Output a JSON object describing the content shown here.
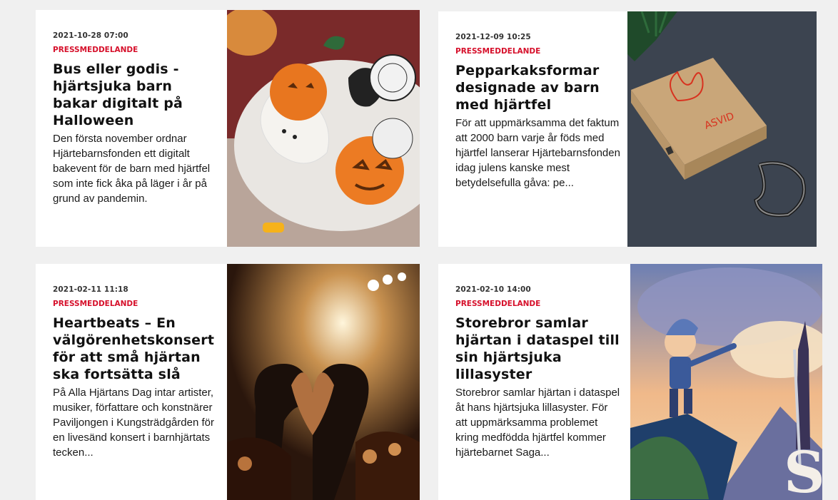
{
  "cards": [
    {
      "date": "2021-10-28 07:00",
      "category": "PRESSMEDDELANDE",
      "title": "Bus eller godis - hjärtsjuka barn bakar digitalt på Halloween",
      "excerpt": "Den första november ordnar Hjärtebarnsfonden ett digitalt bakevent för de barn med hjärtfel som inte fick åka på läger i år på grund av pandemin.",
      "image": "halloween-cookies-photo"
    },
    {
      "date": "2021-12-09 10:25",
      "category": "PRESSMEDDELANDE",
      "title": "Pepparkaksformar designade av barn med hjärtfel",
      "excerpt": "För att uppmärksamma det faktum att 2000 barn varje år föds med hjärtfel lanserar Hjärtebarnsfonden idag julens kanske mest betydelsefulla gåva: pe...",
      "image": "cookie-cutter-box-photo"
    },
    {
      "date": "2021-02-11 11:18",
      "category": "PRESSMEDDELANDE",
      "title": "Heartbeats – En välgörenhetskonsert för att små hjärtan ska fortsätta slå",
      "excerpt": "På Alla Hjärtans Dag intar artister, musiker, författare och konstnärer Paviljongen i Kungsträdgården för en livesänd konsert i barnhjärtats tecken...",
      "image": "concert-heart-hands-photo"
    },
    {
      "date": "2021-02-10 14:00",
      "category": "PRESSMEDDELANDE",
      "title": "Storebror samlar hjärtan i dataspel till sin hjärtsjuka lillasyster",
      "excerpt": "Storebror samlar hjärtan i dataspel åt hans hjärtsjuka lillasyster. För att uppmärksamma problemet kring medfödda hjärtfel kommer hjärtebarnet Saga...",
      "image": "game-hero-illustration"
    }
  ],
  "colors": {
    "category": "#d6102b",
    "card_bg": "#ffffff",
    "page_bg": "#f0f0f0"
  }
}
